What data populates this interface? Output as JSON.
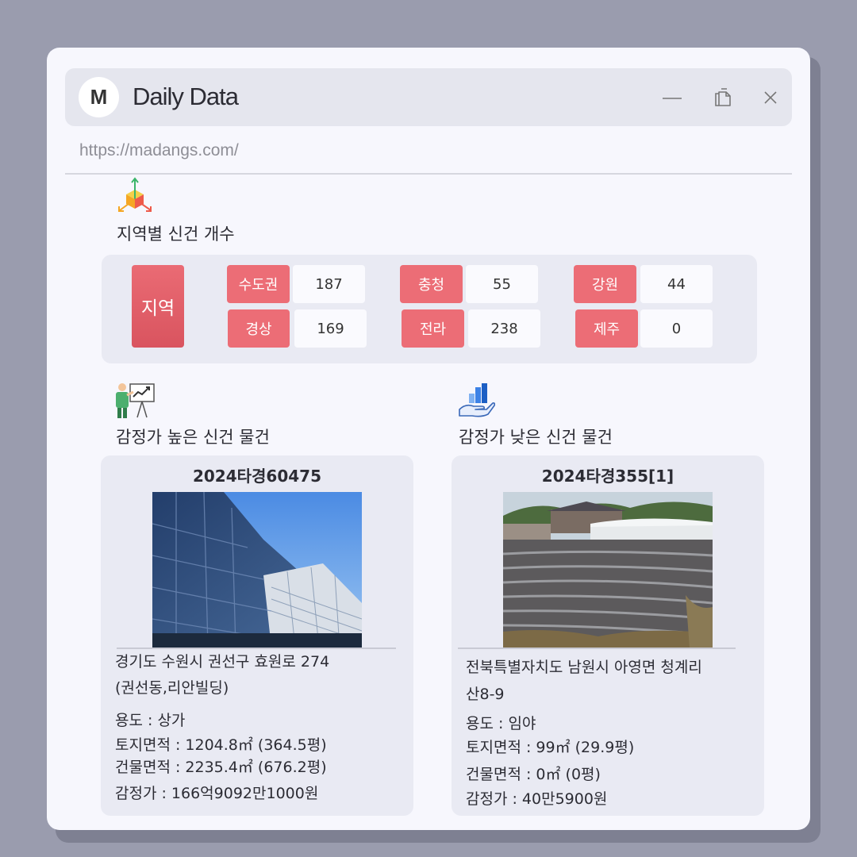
{
  "window": {
    "avatar_letter": "M",
    "title": "Daily Data",
    "url": "https://madangs.com/"
  },
  "region_section": {
    "title": "지역별 신건 개수",
    "label": "지역",
    "regions": [
      {
        "name": "수도권",
        "count": "187"
      },
      {
        "name": "충청",
        "count": "55"
      },
      {
        "name": "강원",
        "count": "44"
      },
      {
        "name": "경상",
        "count": "169"
      },
      {
        "name": "전라",
        "count": "238"
      },
      {
        "name": "제주",
        "count": "0"
      }
    ]
  },
  "high": {
    "title": "감정가 높은 신건 물건",
    "case_no": "2024타경60475",
    "address_line1": "경기도 수원시 권선구 효원로 274",
    "address_line2": "(권선동,리안빌딩)",
    "usage": "용도 : 상가",
    "land_area": "토지면적 : 1204.8㎡ (364.5평)",
    "building_area": "건물면적 : 2235.4㎡ (676.2평)",
    "appraisal": "감정가 : 166억9092만1000원"
  },
  "low": {
    "title": "감정가 낮은 신건 물건",
    "case_no": "2024타경355[1]",
    "address_line1": "전북특별자치도 남원시 아영면 청계리",
    "address_line2": "산8-9",
    "usage": "용도 : 임야",
    "land_area": "토지면적 : 99㎡ (29.9평)",
    "building_area": "건물면적 : 0㎡ (0평)",
    "appraisal": "감정가 : 40만5900원"
  },
  "colors": {
    "background": "#9a9cae",
    "window": "#f7f7fd",
    "panel": "#e9eaf3",
    "accent": "#ec6d76"
  },
  "icons": [
    "3d-axes-icon",
    "presentation-chart-icon",
    "hand-bar-chart-icon",
    "minimize-icon",
    "copy-icon",
    "close-icon"
  ]
}
